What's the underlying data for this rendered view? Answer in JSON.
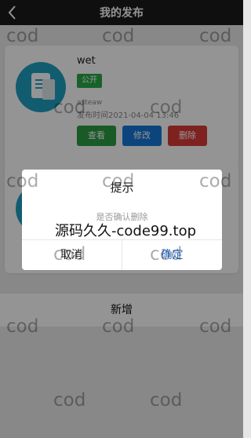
{
  "header": {
    "back_icon": "chevron-left-icon",
    "title": "我的发布"
  },
  "posts": [
    {
      "title": "wet",
      "visibility": "公开",
      "author": "asteaw",
      "publish_time": "发布时间2021-04-04 13:46"
    }
  ],
  "actions": {
    "view": "查看",
    "edit": "修改",
    "delete": "删除"
  },
  "add_button": "新增",
  "dialog": {
    "title": "提示",
    "message": "是否确认删除",
    "cancel": "取消",
    "confirm": "确定"
  },
  "watermark": {
    "text": "cod",
    "banner": "源码久久-code99.top"
  },
  "colors": {
    "header": "#1b1b1b",
    "avatar": "#1f9fc1",
    "public_badge": "#2aa84a",
    "view": "#2b9b43",
    "edit": "#1677d8",
    "delete": "#d93b36",
    "confirm": "#2b74d8"
  }
}
